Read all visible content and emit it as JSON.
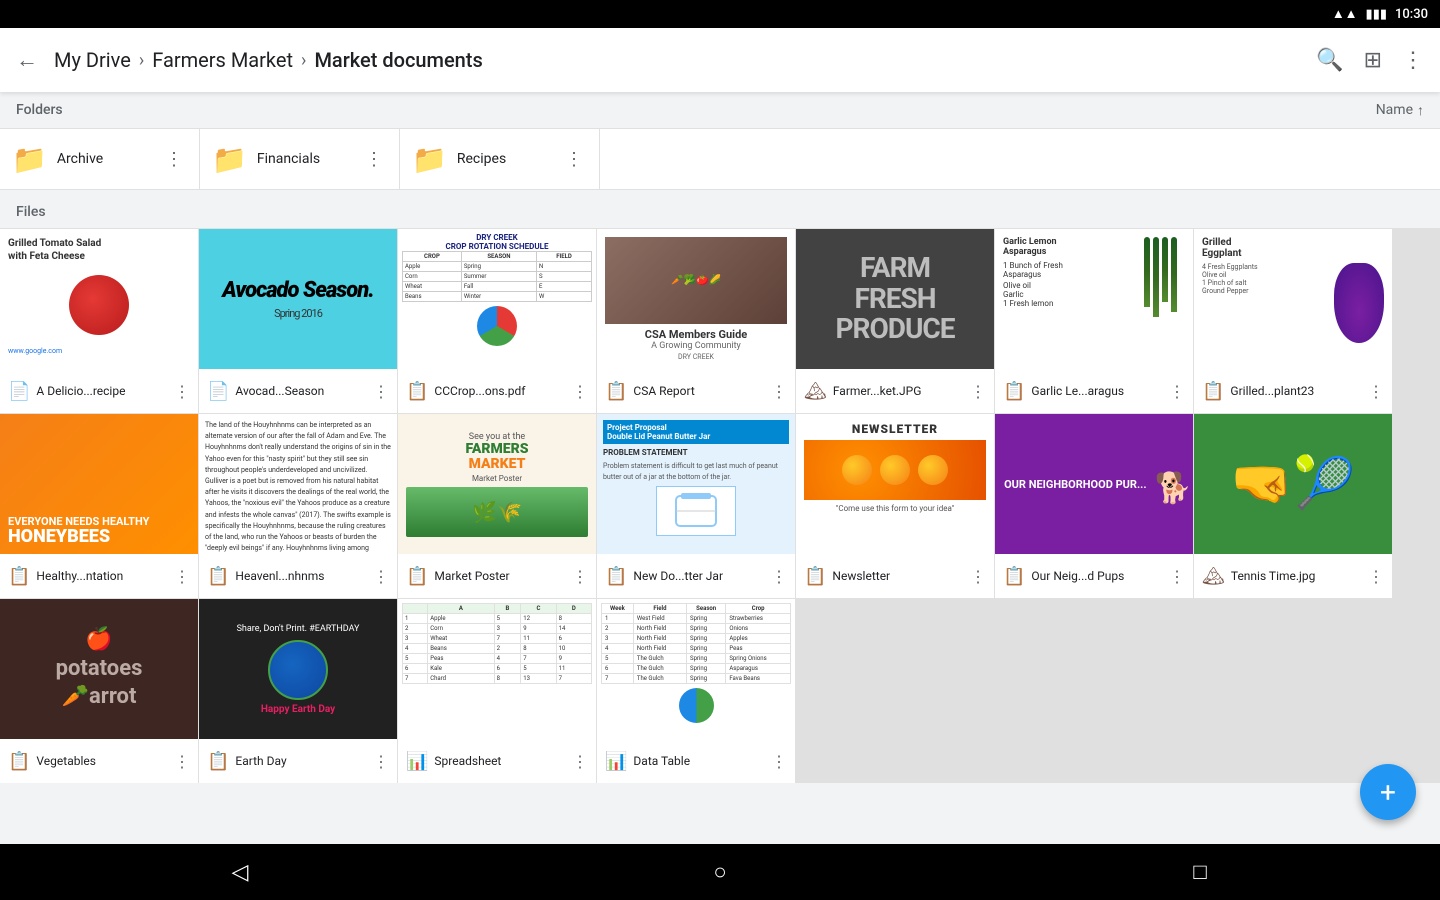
{
  "statusBar": {
    "time": "10:30",
    "wifi": "▲",
    "battery": "🔋"
  },
  "toolbar": {
    "backLabel": "←",
    "breadcrumbs": [
      "My Drive",
      "Farmers Market",
      "Market documents"
    ],
    "searchIcon": "🔍",
    "gridIcon": "⊞",
    "moreIcon": "⋮"
  },
  "sortBar": {
    "label": "Name",
    "arrow": "↑"
  },
  "sections": {
    "folders": "Folders",
    "files": "Files"
  },
  "folders": [
    {
      "name": "Archive",
      "color": "#616161"
    },
    {
      "name": "Financials",
      "color": "#f9a825"
    },
    {
      "name": "Recipes",
      "color": "#8e24aa"
    }
  ],
  "files": [
    {
      "name": "A Delicio...recipe",
      "type": "doc",
      "typeIcon": "📄"
    },
    {
      "name": "Avocad...Season",
      "type": "doc",
      "typeIcon": "📄"
    },
    {
      "name": "CCCrop...ons.pdf",
      "type": "pdf",
      "typeIcon": "📋"
    },
    {
      "name": "CSA Report",
      "type": "pdf",
      "typeIcon": "📋"
    },
    {
      "name": "Farmer...ket.JPG",
      "type": "img",
      "typeIcon": "🖼"
    },
    {
      "name": "Garlic Le...aragus",
      "type": "pdf",
      "typeIcon": "📋"
    },
    {
      "name": "Grilled...plant23",
      "type": "pdf",
      "typeIcon": "📋"
    },
    {
      "name": "Healthy...ntation",
      "type": "pdf",
      "typeIcon": "📋"
    },
    {
      "name": "Heavenl...nhnms",
      "type": "pdf",
      "typeIcon": "📋"
    },
    {
      "name": "Market Poster",
      "type": "pdf",
      "typeIcon": "📋"
    },
    {
      "name": "New Do...tter Jar",
      "type": "pdf",
      "typeIcon": "📋"
    },
    {
      "name": "Newsletter",
      "type": "pdf",
      "typeIcon": "📋"
    },
    {
      "name": "Our Neig...d Pups",
      "type": "pdf",
      "typeIcon": "📋"
    },
    {
      "name": "Tennis Time.jpg",
      "type": "img",
      "typeIcon": "🖼"
    },
    {
      "name": "Vegetables",
      "type": "img",
      "typeIcon": "🖼"
    },
    {
      "name": "Earth Day",
      "type": "pdf",
      "typeIcon": "📋"
    },
    {
      "name": "Spreadsheet",
      "type": "sheet",
      "typeIcon": "📊"
    },
    {
      "name": "Data Table",
      "type": "sheet",
      "typeIcon": "📊"
    }
  ],
  "fab": {
    "label": "+"
  },
  "bottomNav": {
    "back": "◁",
    "home": "○",
    "recent": "□"
  }
}
